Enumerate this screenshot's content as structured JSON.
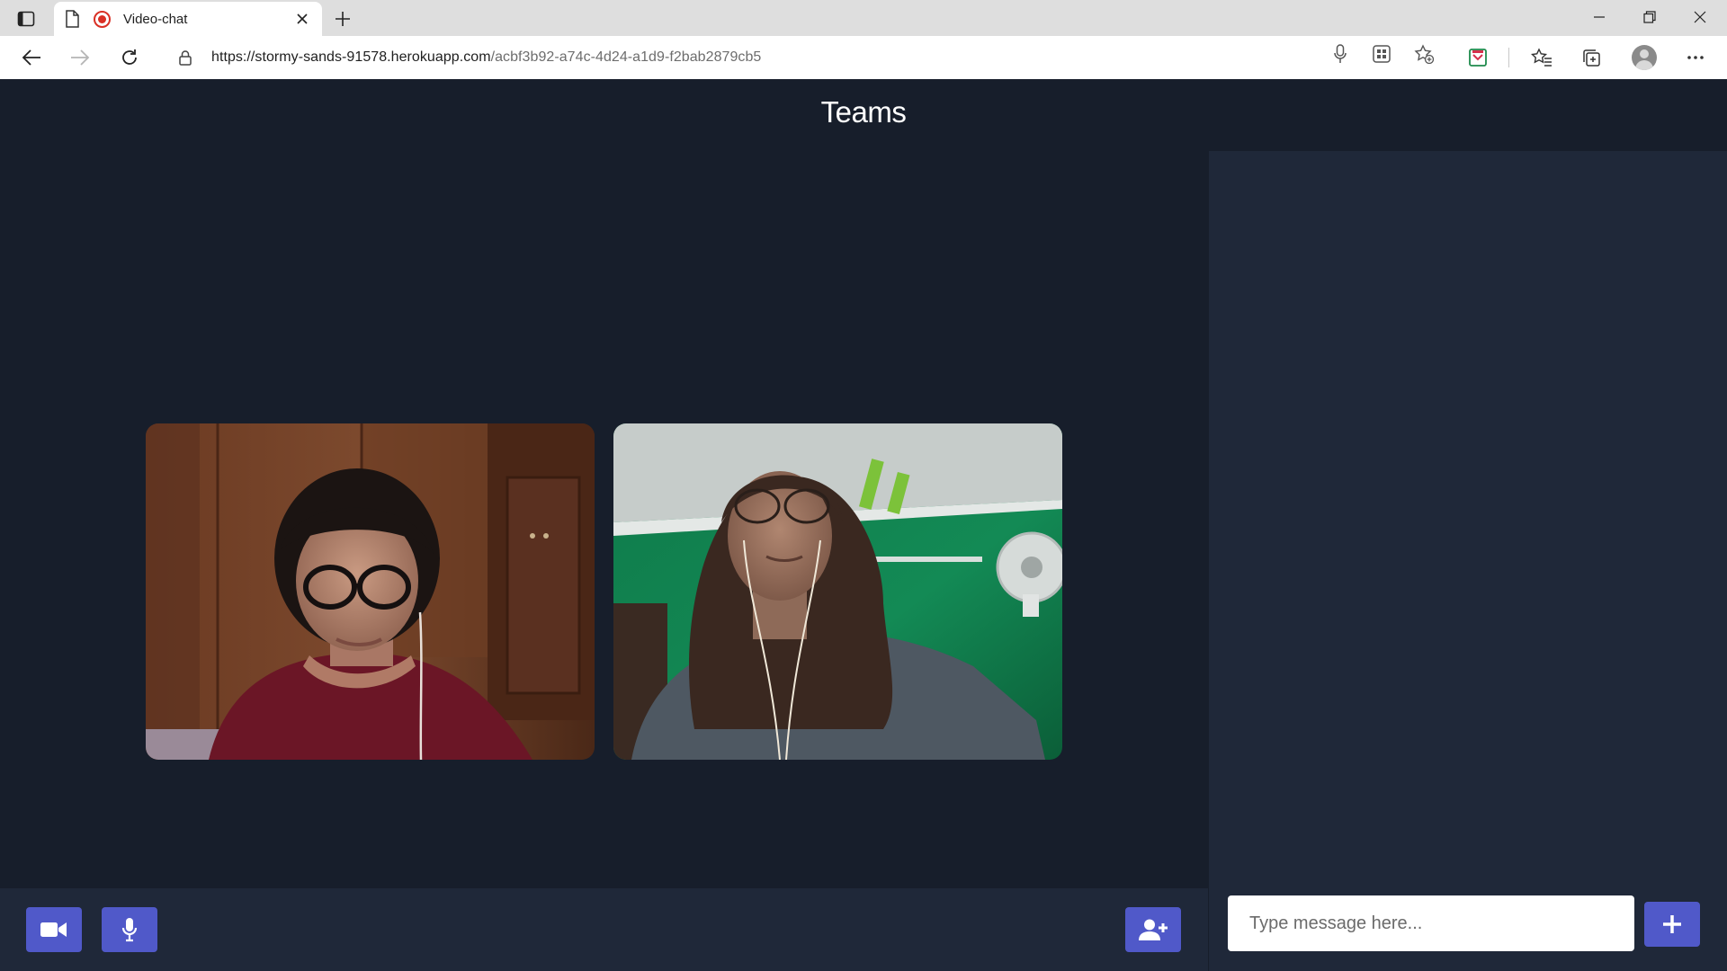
{
  "browser": {
    "tab_title": "Video-chat",
    "url_host": "https://stormy-sands-91578.herokuapp.com",
    "url_path": "/acbf3b92-a74c-4d24-a1d9-f2bab2879cb5"
  },
  "app": {
    "title": "Teams",
    "chat_placeholder": "Type message here...",
    "colors": {
      "background": "#171e2b",
      "panel": "#1f2839",
      "accent": "#5059c9"
    }
  },
  "videos": [
    {
      "name": "participant-video-1"
    },
    {
      "name": "participant-video-2"
    }
  ],
  "icons": {
    "camera": "video-camera-icon",
    "mic": "microphone-icon",
    "invite": "add-user-icon",
    "send": "plus-icon"
  }
}
